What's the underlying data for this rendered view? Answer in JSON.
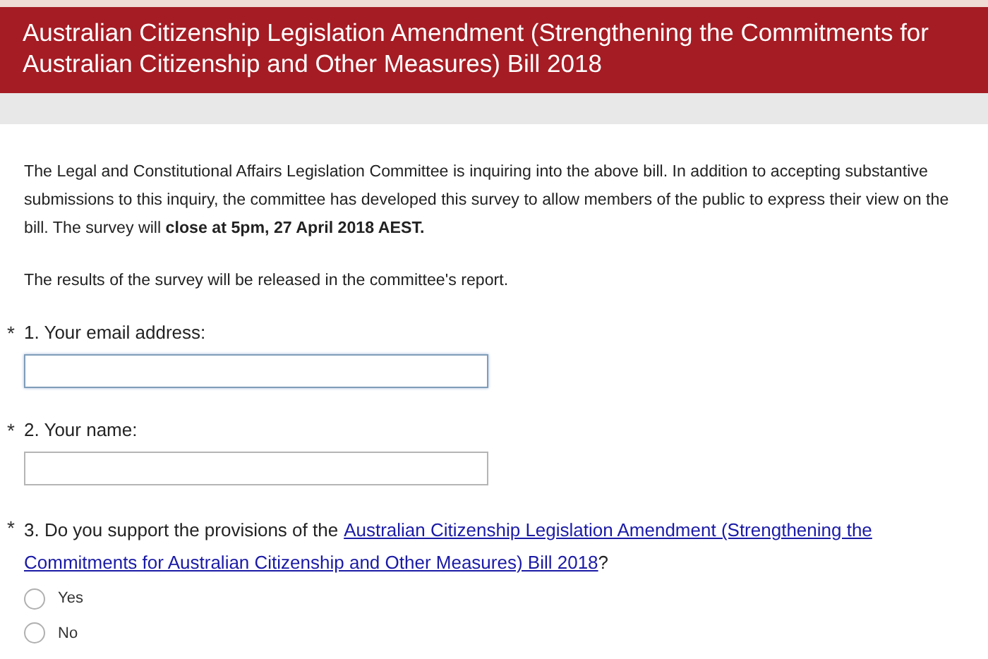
{
  "header": {
    "title": "Australian Citizenship Legislation Amendment (Strengthening the Commitments for Australian Citizenship and Other Measures) Bill 2018"
  },
  "intro": [
    "The Legal and Constitutional Affairs Legislation Committee is inquiring into the above bill. In addition to accepting substantive submissions to this inquiry, the committee has developed this survey to allow members of the public to express their view on the bill. The survey will **close at 5pm, 27 April 2018 AEST.**",
    "The results of the survey will be released in the committee's report."
  ],
  "questions": [
    {
      "kind": "text",
      "required_mark": "*",
      "label": "1. Your email address:",
      "focused": true
    },
    {
      "kind": "text",
      "required_mark": "*",
      "label": "2. Your name:",
      "focused": false
    },
    {
      "kind": "radio",
      "required_mark": "*",
      "label": "3. Do you support the provisions of the",
      "link_lines": [
        "Australian Citizenship Legislation Amendment (Strengthening the",
        "Commitments for Australian Citizenship and Other Measures) Bill 2018"
      ],
      "label_end": "?",
      "options": [
        {
          "label": "Yes",
          "selected": false
        },
        {
          "label": "No",
          "selected": false
        }
      ]
    }
  ]
}
